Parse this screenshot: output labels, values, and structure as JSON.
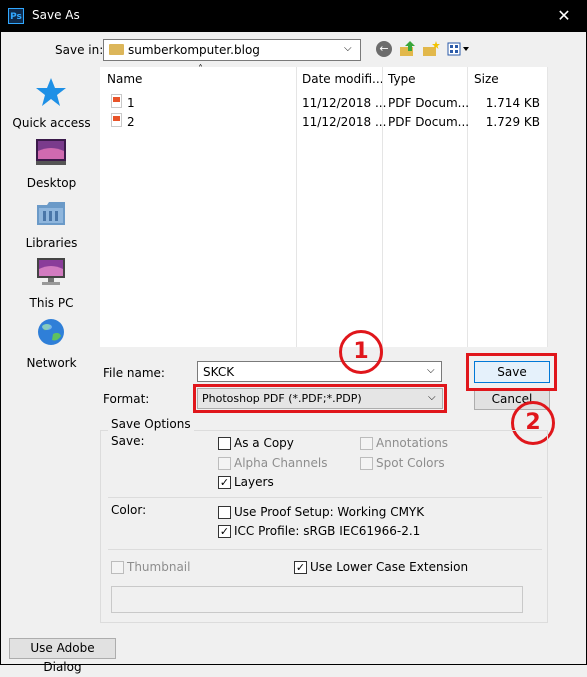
{
  "window": {
    "title": "Save As",
    "app_badge": "Ps",
    "close_glyph": "✕"
  },
  "save_in": {
    "label": "Save in:",
    "value": "sumberkomputer.blog"
  },
  "toolbar": {
    "icons": [
      "back-icon",
      "up-folder-icon",
      "new-folder-icon",
      "view-menu-icon"
    ]
  },
  "places": [
    {
      "label": "Quick access",
      "icon": "star-icon"
    },
    {
      "label": "Desktop",
      "icon": "desktop-icon"
    },
    {
      "label": "Libraries",
      "icon": "libraries-icon"
    },
    {
      "label": "This PC",
      "icon": "computer-icon"
    },
    {
      "label": "Network",
      "icon": "network-icon"
    }
  ],
  "file_list": {
    "columns": [
      "Name",
      "Date modifi...",
      "Type",
      "Size"
    ],
    "rows": [
      {
        "name": "1",
        "date": "11/12/2018 ...",
        "type": "PDF Docum...",
        "size": "1.714 KB"
      },
      {
        "name": "2",
        "date": "11/12/2018 ...",
        "type": "PDF Docum...",
        "size": "1.729 KB"
      }
    ]
  },
  "filename": {
    "label": "File name:",
    "value": "SKCK"
  },
  "format": {
    "label": "Format:",
    "value": "Photoshop PDF (*.PDF;*.PDP)"
  },
  "buttons": {
    "save": "Save",
    "cancel": "Cancel",
    "adobe_dialog": "Use Adobe Dialog"
  },
  "annotations": {
    "badge1": "1",
    "badge2": "2",
    "color": "#e0161b"
  },
  "options": {
    "title": "Save Options",
    "save_label": "Save:",
    "as_a_copy": {
      "label": "As a Copy",
      "checked": false,
      "enabled": true
    },
    "annotations": {
      "label": "Annotations",
      "checked": false,
      "enabled": false
    },
    "alpha_channels": {
      "label": "Alpha Channels",
      "checked": false,
      "enabled": false
    },
    "spot_colors": {
      "label": "Spot Colors",
      "checked": false,
      "enabled": false
    },
    "layers": {
      "label": "Layers",
      "checked": true,
      "enabled": true
    },
    "color_label": "Color:",
    "proof_setup": {
      "label": "Use Proof Setup:  Working CMYK",
      "checked": false,
      "enabled": true
    },
    "icc_profile": {
      "label": "ICC Profile:  sRGB IEC61966-2.1",
      "checked": true,
      "enabled": true
    },
    "thumbnail": {
      "label": "Thumbnail",
      "checked": false,
      "enabled": false
    },
    "lower_case": {
      "label": "Use Lower Case Extension",
      "checked": true,
      "enabled": true
    }
  }
}
